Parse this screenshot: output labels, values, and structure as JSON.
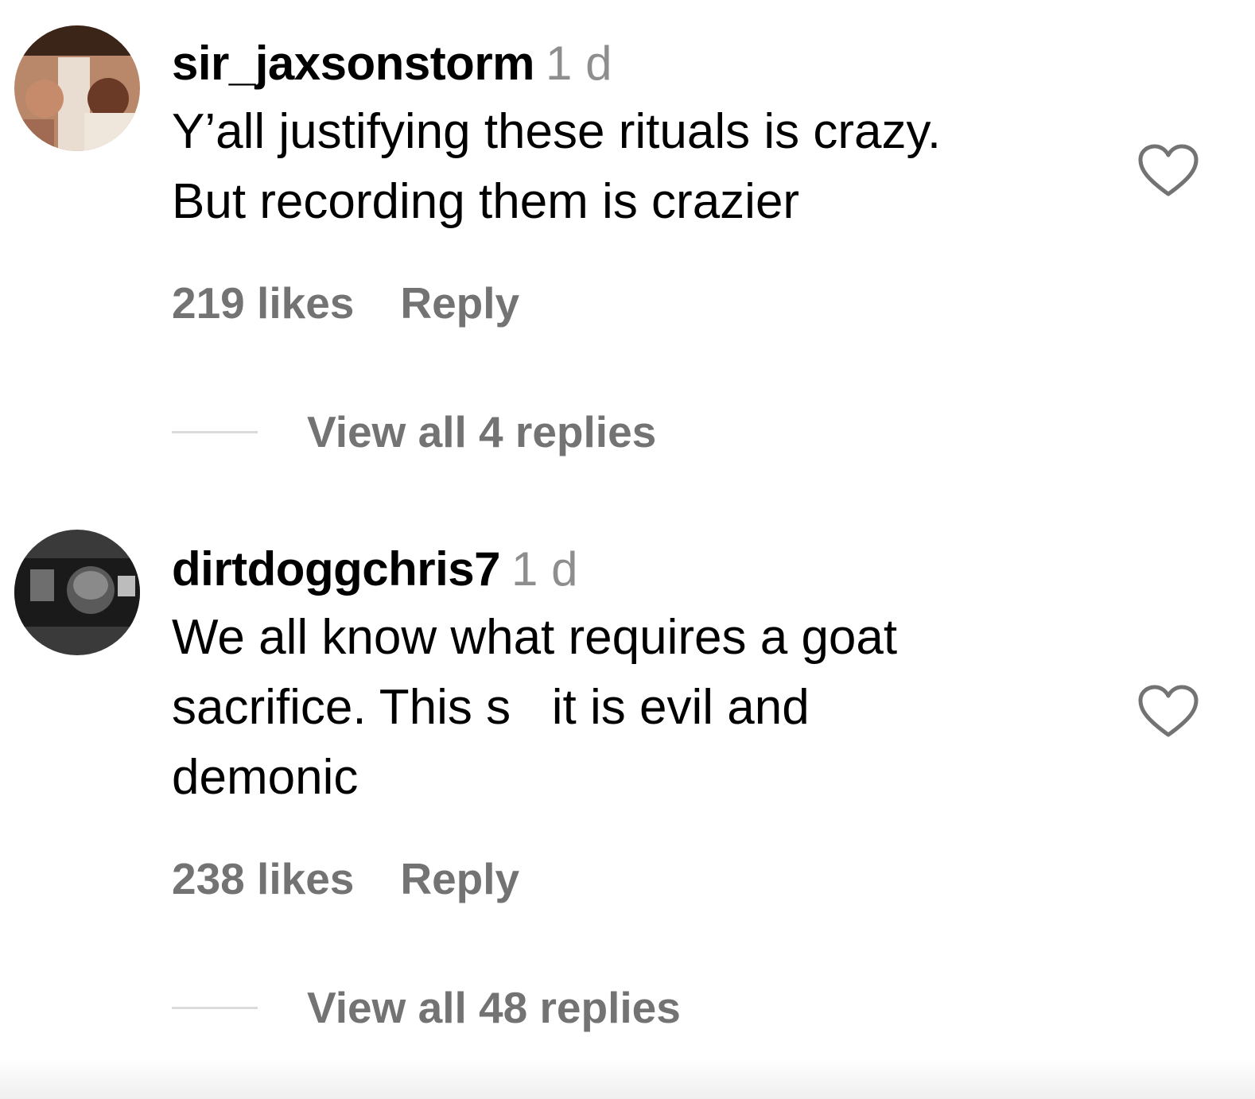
{
  "comments": [
    {
      "username": "sir_jaxsonstorm",
      "time": "1 d",
      "text": "Y’all justifying these rituals is crazy.\nBut recording them is crazier",
      "likes": "219 likes",
      "reply_label": "Reply",
      "view_replies": "View all 4 replies",
      "like_icon": "heart-outline-icon"
    },
    {
      "username": "dirtdoggchris7",
      "time": "1 d",
      "text": "We all know what requires a goat\nsacrifice. This s   it is evil and\ndemonic",
      "likes": "238 likes",
      "reply_label": "Reply",
      "view_replies": "View all 48 replies",
      "like_icon": "heart-outline-icon"
    }
  ],
  "colors": {
    "text": "#000000",
    "secondary": "#737373",
    "timestamp": "#8e8e8e",
    "divider": "#dbdbdb",
    "background": "#ffffff"
  }
}
